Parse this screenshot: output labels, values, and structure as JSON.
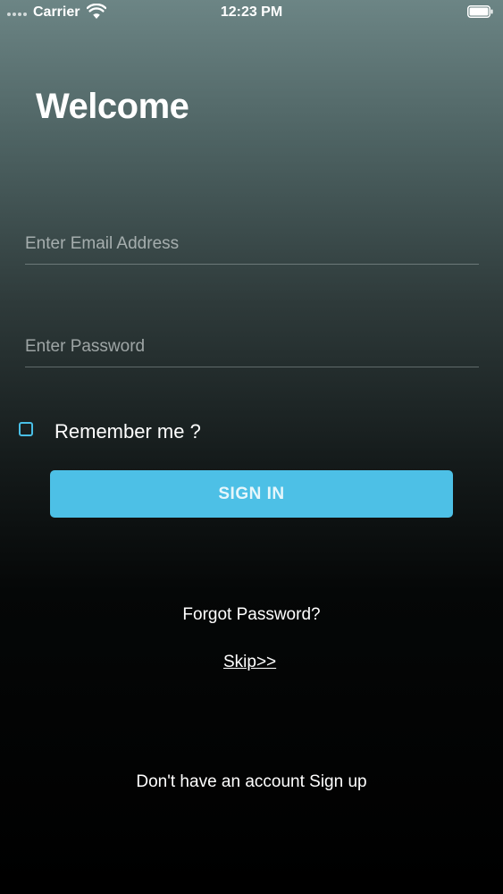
{
  "status_bar": {
    "carrier": "Carrier",
    "time": "12:23 PM",
    "signal_icon": "signal-dots-icon",
    "wifi_icon": "wifi-icon",
    "battery_icon": "battery-icon"
  },
  "login": {
    "title": "Welcome",
    "email_placeholder": "Enter Email Address",
    "email_value": "",
    "password_placeholder": "Enter Password",
    "password_value": "",
    "remember_label": "Remember me ?",
    "remember_checked": false,
    "signin_label": "SIGN IN",
    "forgot_label": "Forgot Password?",
    "skip_label": "Skip>>",
    "signup_label": "Don't have an account Sign up"
  },
  "colors": {
    "accent": "#4dc0e6",
    "checkbox_border": "#49bfe6",
    "text": "#ffffff"
  }
}
